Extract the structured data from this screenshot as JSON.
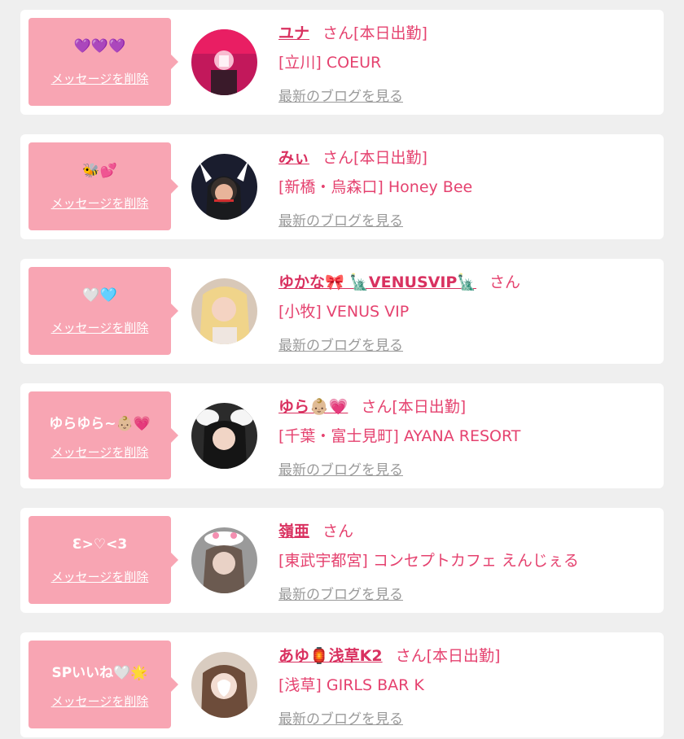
{
  "cards": [
    {
      "message": "💜💜💜",
      "delete_label": "メッセージを削除",
      "name": "ユナ",
      "honorific": "さん",
      "status": "[本日出勤]",
      "shop": "[立川] COEUR",
      "blog_link": "最新のブログを見る"
    },
    {
      "message": "🐝💕",
      "delete_label": "メッセージを削除",
      "name": "みぃ",
      "honorific": "さん",
      "status": "[本日出勤]",
      "shop": "[新橋・烏森口] Honey Bee",
      "blog_link": "最新のブログを見る"
    },
    {
      "message": "🤍🩵",
      "delete_label": "メッセージを削除",
      "name": "ゆかな🎀 🗽VENUSVIP🗽",
      "honorific": "さん",
      "status": "",
      "shop": "[小牧] VENUS VIP",
      "blog_link": "最新のブログを見る"
    },
    {
      "message": "ゆらゆら~👶🏼💗",
      "delete_label": "メッセージを削除",
      "name": "ゆら👶🏼💗",
      "honorific": "さん",
      "status": "[本日出勤]",
      "shop": "[千葉・富士見町] AYANA RESORT",
      "blog_link": "最新のブログを見る"
    },
    {
      "message": "Ɛ>♡<3",
      "delete_label": "メッセージを削除",
      "name": "嶺亜",
      "honorific": "さん",
      "status": "",
      "shop": "[東武宇都宮] コンセプトカフェ えんじぇる",
      "blog_link": "最新のブログを見る"
    },
    {
      "message": "SPいいね🤍🌟",
      "delete_label": "メッセージを削除",
      "name": "あゆ🏮浅草K2",
      "honorific": "さん",
      "status": "[本日出勤]",
      "shop": "[浅草] GIRLS BAR K",
      "blog_link": "最新のブログを見る"
    }
  ]
}
